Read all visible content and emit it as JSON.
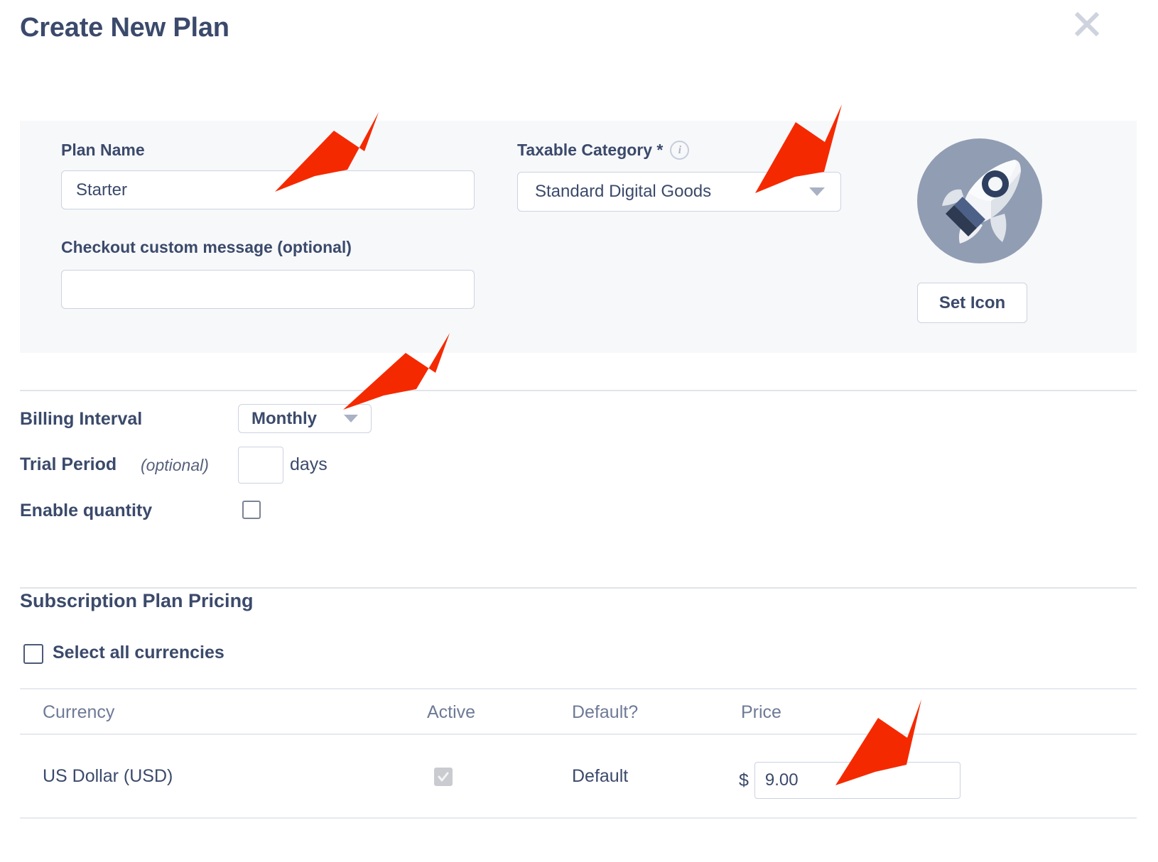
{
  "modal": {
    "title": "Create New Plan",
    "close_label": "close-icon"
  },
  "form": {
    "plan_name": {
      "label": "Plan Name",
      "value": "Starter",
      "placeholder": ""
    },
    "checkout_message": {
      "label": "Checkout custom message (optional)",
      "value": "",
      "placeholder": ""
    },
    "taxable_category": {
      "label": "Taxable Category *",
      "info_glyph": "i",
      "selected": "Standard Digital Goods"
    },
    "plan_icon": {
      "icon_name": "rocket-icon",
      "set_icon_label": "Set Icon",
      "circle_color": "#919db3"
    }
  },
  "billing": {
    "interval": {
      "label": "Billing Interval",
      "selected": "Monthly"
    },
    "trial_period": {
      "label": "Trial Period",
      "optional_text": "(optional)",
      "value": "",
      "unit": "days"
    },
    "enable_quantity": {
      "label": "Enable quantity",
      "checked": false
    }
  },
  "pricing": {
    "section_title": "Subscription Plan Pricing",
    "select_all": {
      "label": "Select all currencies",
      "checked": false
    },
    "columns": [
      "Currency",
      "Active",
      "Default?",
      "Price"
    ],
    "rows": [
      {
        "currency": "US Dollar (USD)",
        "active": true,
        "default": "Default",
        "currency_symbol": "$",
        "price": "9.00"
      }
    ]
  },
  "annotations": {
    "arrow_color": "#f52900",
    "arrows": [
      {
        "name": "arrow-plan-name"
      },
      {
        "name": "arrow-taxable-category"
      },
      {
        "name": "arrow-billing-interval"
      },
      {
        "name": "arrow-price"
      }
    ]
  },
  "colors": {
    "text_primary": "#3b4a6b",
    "text_muted": "#6e7a96",
    "panel_bg": "#f7f8fa",
    "border": "#ccd2e0",
    "divider": "#e2e4ea"
  }
}
